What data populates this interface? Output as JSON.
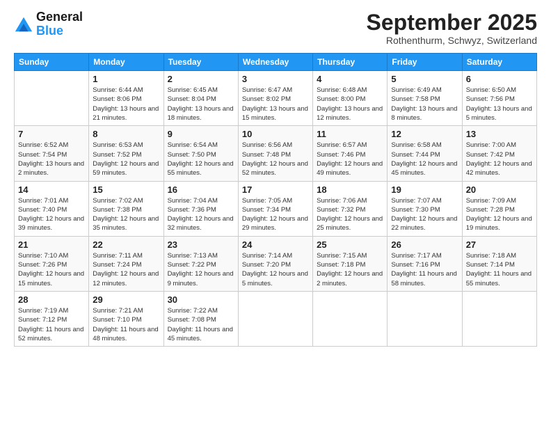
{
  "header": {
    "logo_line1": "General",
    "logo_line2": "Blue",
    "month": "September 2025",
    "location": "Rothenthurm, Schwyz, Switzerland"
  },
  "weekdays": [
    "Sunday",
    "Monday",
    "Tuesday",
    "Wednesday",
    "Thursday",
    "Friday",
    "Saturday"
  ],
  "weeks": [
    [
      {
        "day": "",
        "sunrise": "",
        "sunset": "",
        "daylight": ""
      },
      {
        "day": "1",
        "sunrise": "Sunrise: 6:44 AM",
        "sunset": "Sunset: 8:06 PM",
        "daylight": "Daylight: 13 hours and 21 minutes."
      },
      {
        "day": "2",
        "sunrise": "Sunrise: 6:45 AM",
        "sunset": "Sunset: 8:04 PM",
        "daylight": "Daylight: 13 hours and 18 minutes."
      },
      {
        "day": "3",
        "sunrise": "Sunrise: 6:47 AM",
        "sunset": "Sunset: 8:02 PM",
        "daylight": "Daylight: 13 hours and 15 minutes."
      },
      {
        "day": "4",
        "sunrise": "Sunrise: 6:48 AM",
        "sunset": "Sunset: 8:00 PM",
        "daylight": "Daylight: 13 hours and 12 minutes."
      },
      {
        "day": "5",
        "sunrise": "Sunrise: 6:49 AM",
        "sunset": "Sunset: 7:58 PM",
        "daylight": "Daylight: 13 hours and 8 minutes."
      },
      {
        "day": "6",
        "sunrise": "Sunrise: 6:50 AM",
        "sunset": "Sunset: 7:56 PM",
        "daylight": "Daylight: 13 hours and 5 minutes."
      }
    ],
    [
      {
        "day": "7",
        "sunrise": "Sunrise: 6:52 AM",
        "sunset": "Sunset: 7:54 PM",
        "daylight": "Daylight: 13 hours and 2 minutes."
      },
      {
        "day": "8",
        "sunrise": "Sunrise: 6:53 AM",
        "sunset": "Sunset: 7:52 PM",
        "daylight": "Daylight: 12 hours and 59 minutes."
      },
      {
        "day": "9",
        "sunrise": "Sunrise: 6:54 AM",
        "sunset": "Sunset: 7:50 PM",
        "daylight": "Daylight: 12 hours and 55 minutes."
      },
      {
        "day": "10",
        "sunrise": "Sunrise: 6:56 AM",
        "sunset": "Sunset: 7:48 PM",
        "daylight": "Daylight: 12 hours and 52 minutes."
      },
      {
        "day": "11",
        "sunrise": "Sunrise: 6:57 AM",
        "sunset": "Sunset: 7:46 PM",
        "daylight": "Daylight: 12 hours and 49 minutes."
      },
      {
        "day": "12",
        "sunrise": "Sunrise: 6:58 AM",
        "sunset": "Sunset: 7:44 PM",
        "daylight": "Daylight: 12 hours and 45 minutes."
      },
      {
        "day": "13",
        "sunrise": "Sunrise: 7:00 AM",
        "sunset": "Sunset: 7:42 PM",
        "daylight": "Daylight: 12 hours and 42 minutes."
      }
    ],
    [
      {
        "day": "14",
        "sunrise": "Sunrise: 7:01 AM",
        "sunset": "Sunset: 7:40 PM",
        "daylight": "Daylight: 12 hours and 39 minutes."
      },
      {
        "day": "15",
        "sunrise": "Sunrise: 7:02 AM",
        "sunset": "Sunset: 7:38 PM",
        "daylight": "Daylight: 12 hours and 35 minutes."
      },
      {
        "day": "16",
        "sunrise": "Sunrise: 7:04 AM",
        "sunset": "Sunset: 7:36 PM",
        "daylight": "Daylight: 12 hours and 32 minutes."
      },
      {
        "day": "17",
        "sunrise": "Sunrise: 7:05 AM",
        "sunset": "Sunset: 7:34 PM",
        "daylight": "Daylight: 12 hours and 29 minutes."
      },
      {
        "day": "18",
        "sunrise": "Sunrise: 7:06 AM",
        "sunset": "Sunset: 7:32 PM",
        "daylight": "Daylight: 12 hours and 25 minutes."
      },
      {
        "day": "19",
        "sunrise": "Sunrise: 7:07 AM",
        "sunset": "Sunset: 7:30 PM",
        "daylight": "Daylight: 12 hours and 22 minutes."
      },
      {
        "day": "20",
        "sunrise": "Sunrise: 7:09 AM",
        "sunset": "Sunset: 7:28 PM",
        "daylight": "Daylight: 12 hours and 19 minutes."
      }
    ],
    [
      {
        "day": "21",
        "sunrise": "Sunrise: 7:10 AM",
        "sunset": "Sunset: 7:26 PM",
        "daylight": "Daylight: 12 hours and 15 minutes."
      },
      {
        "day": "22",
        "sunrise": "Sunrise: 7:11 AM",
        "sunset": "Sunset: 7:24 PM",
        "daylight": "Daylight: 12 hours and 12 minutes."
      },
      {
        "day": "23",
        "sunrise": "Sunrise: 7:13 AM",
        "sunset": "Sunset: 7:22 PM",
        "daylight": "Daylight: 12 hours and 9 minutes."
      },
      {
        "day": "24",
        "sunrise": "Sunrise: 7:14 AM",
        "sunset": "Sunset: 7:20 PM",
        "daylight": "Daylight: 12 hours and 5 minutes."
      },
      {
        "day": "25",
        "sunrise": "Sunrise: 7:15 AM",
        "sunset": "Sunset: 7:18 PM",
        "daylight": "Daylight: 12 hours and 2 minutes."
      },
      {
        "day": "26",
        "sunrise": "Sunrise: 7:17 AM",
        "sunset": "Sunset: 7:16 PM",
        "daylight": "Daylight: 11 hours and 58 minutes."
      },
      {
        "day": "27",
        "sunrise": "Sunrise: 7:18 AM",
        "sunset": "Sunset: 7:14 PM",
        "daylight": "Daylight: 11 hours and 55 minutes."
      }
    ],
    [
      {
        "day": "28",
        "sunrise": "Sunrise: 7:19 AM",
        "sunset": "Sunset: 7:12 PM",
        "daylight": "Daylight: 11 hours and 52 minutes."
      },
      {
        "day": "29",
        "sunrise": "Sunrise: 7:21 AM",
        "sunset": "Sunset: 7:10 PM",
        "daylight": "Daylight: 11 hours and 48 minutes."
      },
      {
        "day": "30",
        "sunrise": "Sunrise: 7:22 AM",
        "sunset": "Sunset: 7:08 PM",
        "daylight": "Daylight: 11 hours and 45 minutes."
      },
      {
        "day": "",
        "sunrise": "",
        "sunset": "",
        "daylight": ""
      },
      {
        "day": "",
        "sunrise": "",
        "sunset": "",
        "daylight": ""
      },
      {
        "day": "",
        "sunrise": "",
        "sunset": "",
        "daylight": ""
      },
      {
        "day": "",
        "sunrise": "",
        "sunset": "",
        "daylight": ""
      }
    ]
  ]
}
